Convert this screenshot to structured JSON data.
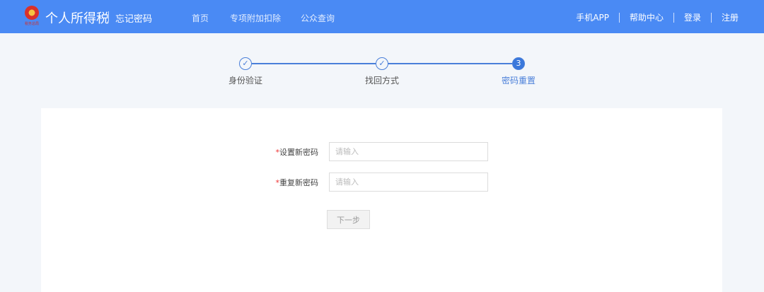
{
  "header": {
    "logo_text": "税务总局",
    "title": "个人所得税",
    "subtitle": "忘记密码",
    "nav": [
      "首页",
      "专项附加扣除",
      "公众查询"
    ],
    "right": [
      "手机APP",
      "帮助中心",
      "登录",
      "注册"
    ]
  },
  "steps": [
    {
      "label": "身份验证",
      "state": "done"
    },
    {
      "label": "找回方式",
      "state": "done"
    },
    {
      "label": "密码重置",
      "number": "3",
      "state": "active"
    }
  ],
  "form": {
    "required_mark": "*",
    "new_password_label": "设置新密码",
    "new_password_placeholder": "请输入",
    "repeat_password_label": "重复新密码",
    "repeat_password_placeholder": "请输入",
    "next_button": "下一步"
  }
}
